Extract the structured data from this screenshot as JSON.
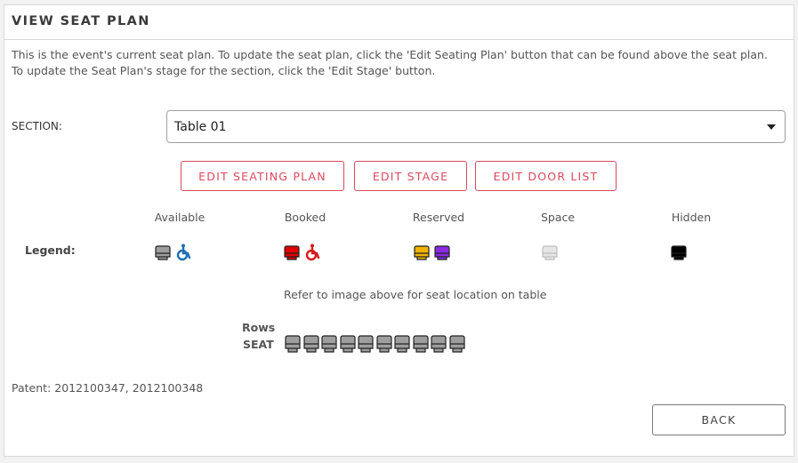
{
  "header": {
    "title": "VIEW SEAT PLAN"
  },
  "description": {
    "line1": "This is the event's current seat plan. To update the seat plan, click the 'Edit Seating Plan' button that can be found above the seat plan.",
    "line2": "To update the Seat Plan's stage for the section, click the 'Edit Stage' button."
  },
  "section": {
    "label": "SECTION:",
    "selected": "Table 01"
  },
  "buttons": {
    "edit_seating_plan": "EDIT SEATING PLAN",
    "edit_stage": "EDIT STAGE",
    "edit_door_list": "EDIT DOOR LIST",
    "back": "BACK"
  },
  "legend": {
    "label": "Legend:",
    "items": [
      {
        "name": "Available",
        "colors": [
          "#9e9e9e",
          "#1e6fb8"
        ]
      },
      {
        "name": "Booked",
        "colors": [
          "#e00000",
          "#d81b1b"
        ]
      },
      {
        "name": "Reserved",
        "colors": [
          "#f0b400",
          "#8a2be2"
        ]
      },
      {
        "name": "Space",
        "colors": [
          "#e6e6e6"
        ]
      },
      {
        "name": "Hidden",
        "colors": [
          "#000000"
        ]
      }
    ]
  },
  "plan": {
    "note": "Refer to image above for seat location on table",
    "rows_label": "Rows",
    "seat_label": "SEAT",
    "seat_count": 10,
    "seat_color": "#9e9e9e"
  },
  "footer": {
    "patent": "Patent: 2012100347, 2012100348"
  }
}
